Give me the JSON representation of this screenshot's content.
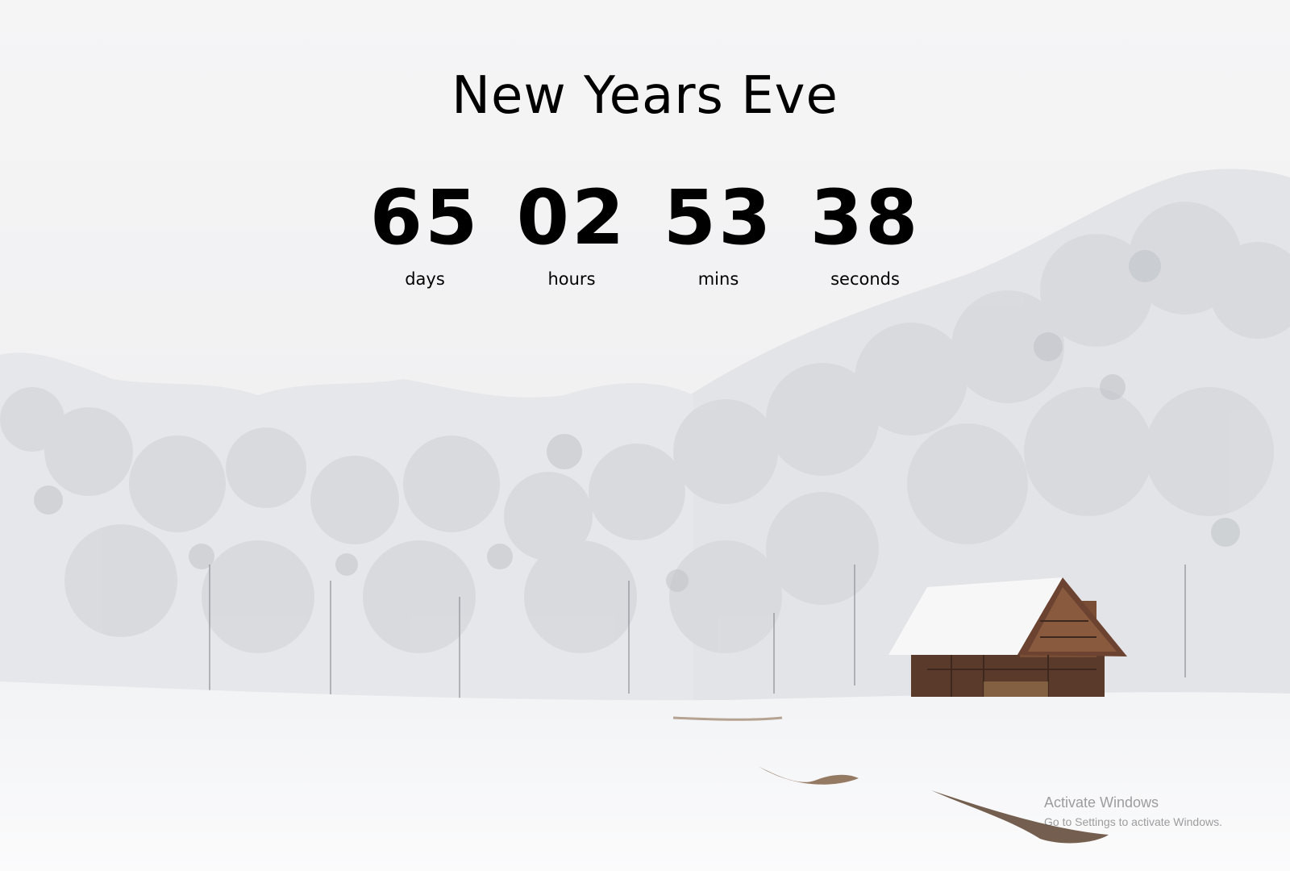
{
  "title": "New Years Eve",
  "countdown": [
    {
      "value": "65",
      "label": "days"
    },
    {
      "value": "02",
      "label": "hours"
    },
    {
      "value": "53",
      "label": "mins"
    },
    {
      "value": "38",
      "label": "seconds"
    }
  ],
  "watermark": {
    "line1": "Activate Windows",
    "line2": "Go to Settings to activate Windows."
  },
  "colors": {
    "text": "#000000",
    "sky": "#f4f4f5",
    "snow": "#ffffff",
    "cabin": "#6b4330"
  }
}
